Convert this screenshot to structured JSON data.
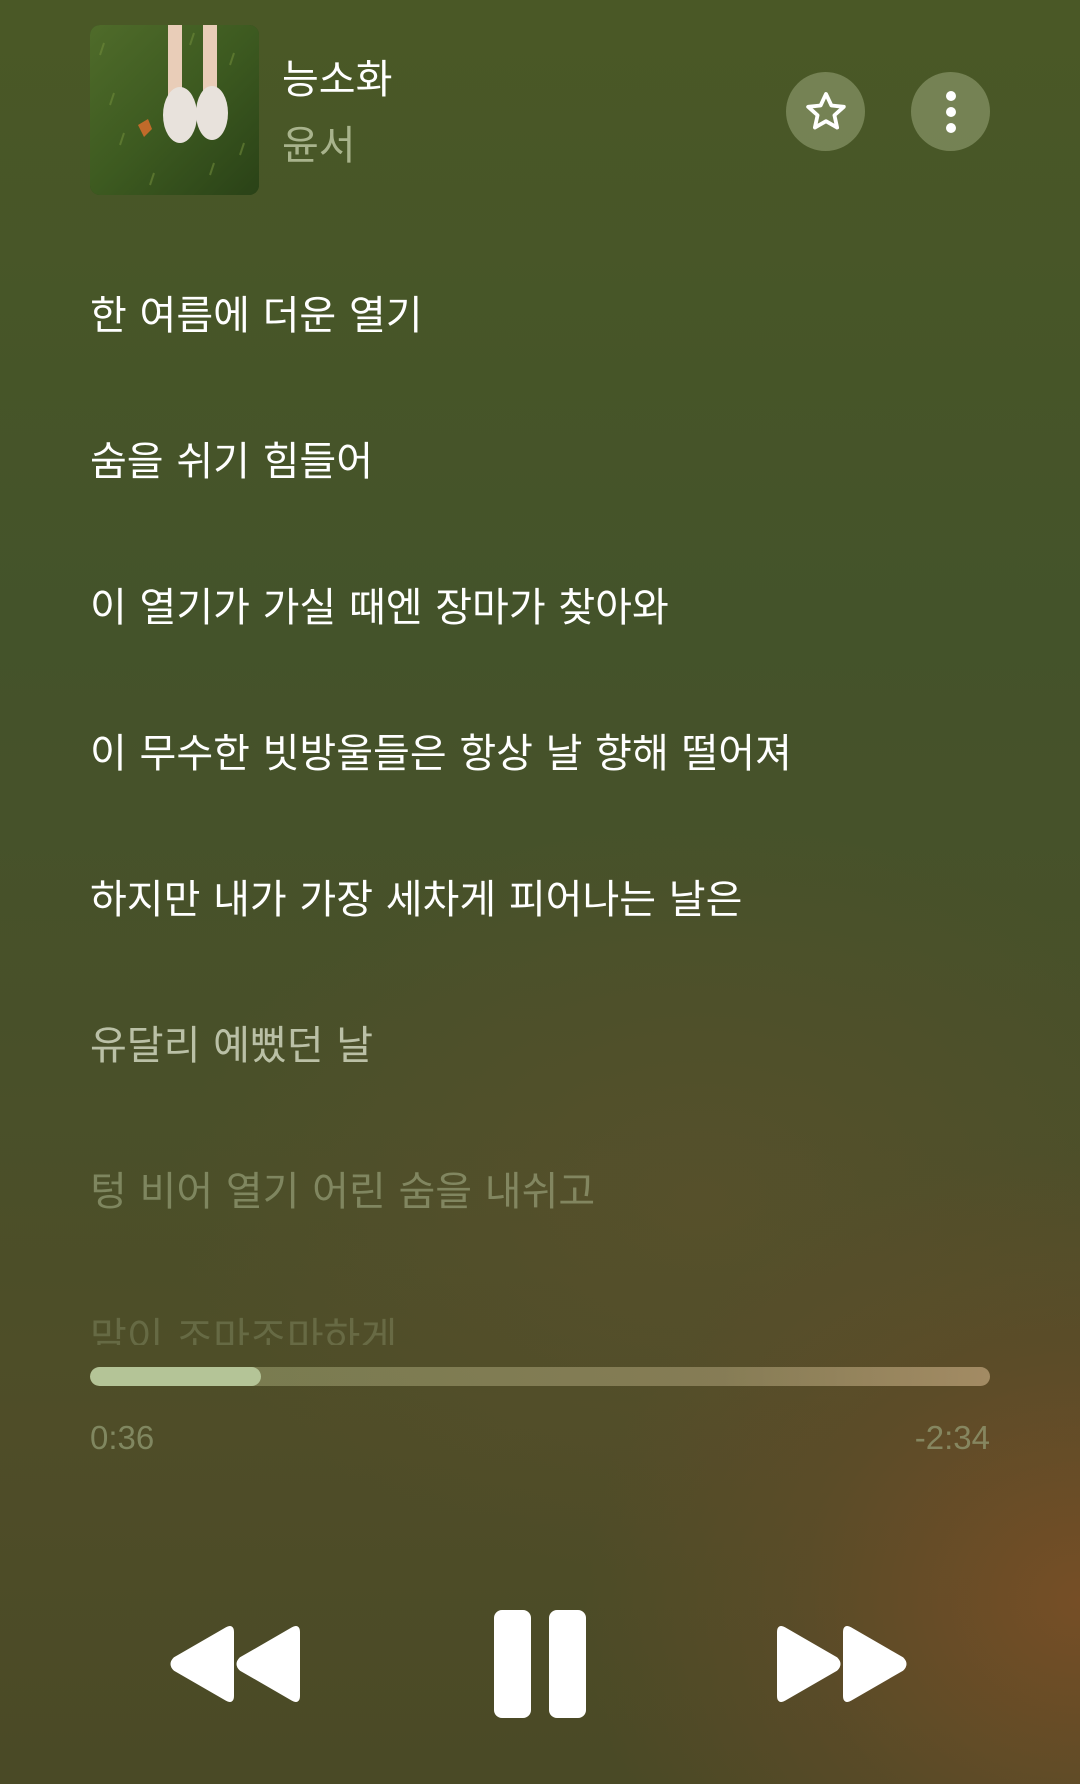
{
  "track": {
    "title": "능소화",
    "artist": "윤서",
    "artwork": "album-artwork-shoes-on-grass"
  },
  "header_buttons": {
    "favorite_icon": "star-outline-icon",
    "more_icon": "more-vertical-icon"
  },
  "lyrics": [
    {
      "text": "한 여름에 더운 열기"
    },
    {
      "text": "숨을 쉬기 힘들어"
    },
    {
      "text": "이 열기가 가실 때엔 장마가 찾아와"
    },
    {
      "text": "이 무수한 빗방울들은 항상 날 향해 떨어져"
    },
    {
      "text": "하지만 내가 가장 세차게 피어나는 날은"
    },
    {
      "text": "유달리 예뻤던 날"
    },
    {
      "text": "텅 비어 열기 어린 숨을 내쉬고"
    },
    {
      "text": "맘이 조마조마하게"
    }
  ],
  "playback": {
    "elapsed": "0:36",
    "remaining": "-2:34",
    "progress_fraction": 0.19
  },
  "controls": {
    "rewind_icon": "rewind-icon",
    "pause_icon": "pause-icon",
    "forward_icon": "fast-forward-icon"
  },
  "colors": {
    "background_top": "#4a5826",
    "background_corner": "#784e26",
    "progress_fill": "#b4c497"
  }
}
